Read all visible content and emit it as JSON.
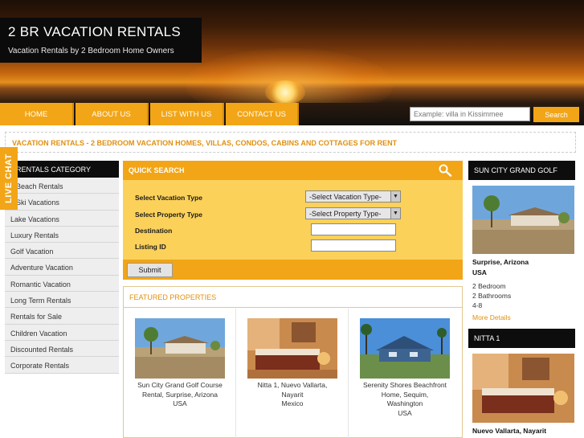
{
  "header": {
    "title": "2 BR VACATION RENTALS",
    "subtitle": "Vacation Rentals by 2 Bedroom Home Owners"
  },
  "nav": {
    "items": [
      {
        "label": "HOME"
      },
      {
        "label": "ABOUT US"
      },
      {
        "label": "LIST WITH US"
      },
      {
        "label": "CONTACT US"
      }
    ]
  },
  "search": {
    "placeholder": "Example: villa in Kissimmee",
    "button": "Search"
  },
  "tagline": "VACATION RENTALS - 2 BEDROOM VACATION HOMES, VILLAS, CONDOS, CABINS AND COTTAGES FOR RENT",
  "live_chat": "LIVE CHAT",
  "sidebar": {
    "heading": "RENTALS CATEGORY",
    "items": [
      {
        "label": "Beach Rentals"
      },
      {
        "label": "Ski Vacations"
      },
      {
        "label": "Lake Vacations"
      },
      {
        "label": "Luxury Rentals"
      },
      {
        "label": "Golf Vacation"
      },
      {
        "label": "Adventure Vacation"
      },
      {
        "label": "Romantic Vacation"
      },
      {
        "label": "Long Term Rentals"
      },
      {
        "label": "Rentals for Sale"
      },
      {
        "label": "Children Vacation"
      },
      {
        "label": "Discounted Rentals"
      },
      {
        "label": "Corporate Rentals"
      }
    ]
  },
  "quick_search": {
    "heading": "QUICK SEARCH",
    "vacation_type_label": "Select Vacation Type",
    "vacation_type_value": "-Select Vacation Type-",
    "property_type_label": "Select Property Type",
    "property_type_value": "-Select Property Type-",
    "destination_label": "Destination",
    "listing_label": "Listing ID",
    "submit": "Submit",
    "dropdown_glyph": "▼"
  },
  "featured": {
    "heading": "FEATURED PROPERTIES",
    "cards": [
      {
        "line1": "Sun City Grand Golf Course",
        "line2": "Rental, Surprise, Arizona",
        "line3": "USA",
        "line4": ""
      },
      {
        "line1": "Nitta 1, Nuevo Vallarta,",
        "line2": "Nayarit",
        "line3": "Mexico",
        "line4": ""
      },
      {
        "line1": "Serenity Shores Beachfront",
        "line2": "Home, Sequim,",
        "line3": "Washington",
        "line4": "USA"
      }
    ]
  },
  "right": {
    "listing1": {
      "heading": "SUN CITY GRAND GOLF",
      "location": "Surprise, Arizona",
      "country": "USA",
      "bedrooms": "2 Bedroom",
      "bathrooms": "2 Bathrooms",
      "sleeps": "4-8",
      "more": "More Details"
    },
    "listing2": {
      "heading": "NITTA 1",
      "location": "Nuevo Vallarta, Nayarit"
    }
  },
  "colors": {
    "accent": "#f2a516",
    "accent_text": "#e0900f",
    "dark": "#0d0d0d",
    "panel": "#fbd15a"
  },
  "icons": [
    "search-icon",
    "dropdown-arrow-icon"
  ]
}
